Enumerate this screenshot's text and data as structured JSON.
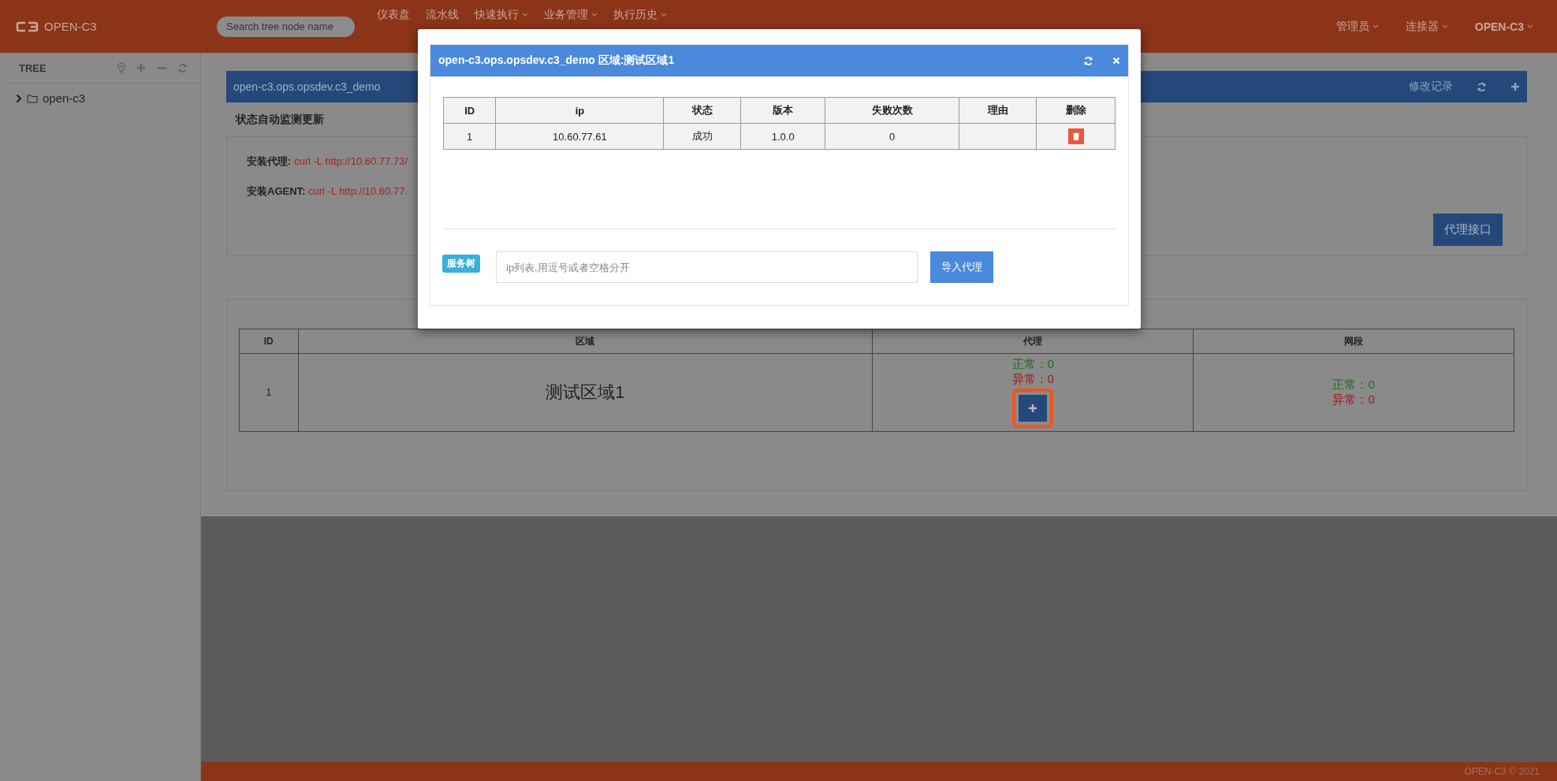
{
  "top_bar": {
    "logo": "OPEN-C3",
    "search": {
      "placeholder": "Search tree node name"
    },
    "menu": [
      {
        "label": "仪表盘",
        "dropdown": false
      },
      {
        "label": "流水线",
        "dropdown": false
      },
      {
        "label": "快速执行",
        "dropdown": true
      },
      {
        "label": "业务管理",
        "dropdown": true
      },
      {
        "label": "执行历史",
        "dropdown": true
      }
    ],
    "right_menu": [
      {
        "label": "管理员",
        "dropdown": true
      },
      {
        "label": "连接器",
        "dropdown": true
      },
      {
        "label": "OPEN-C3",
        "dropdown": true
      }
    ]
  },
  "sidebar": {
    "title": "TREE",
    "tree": [
      {
        "label": "open-c3",
        "expanded": false
      }
    ]
  },
  "main": {
    "header": {
      "title": "open-c3.ops.opsdev.c3_demo",
      "history_link": "修改记录"
    },
    "subtitle": "状态自动监测更新",
    "install": [
      {
        "label": "安装代理:",
        "command": "curl -L http://10.60.77.73/"
      },
      {
        "label": "安装AGENT:",
        "command": "curl -L http://10.60.77."
      }
    ],
    "proxy_button": "代理接口",
    "table": {
      "columns": [
        "ID",
        "区域",
        "代理",
        "网段"
      ],
      "rows": [
        {
          "id": "1",
          "region": "测试区域1",
          "proxy": {
            "normal": "正常：0",
            "abnormal": "异常：0",
            "add_highlighted": true
          },
          "segment": {
            "normal": "正常：0",
            "abnormal": "异常：0"
          }
        }
      ]
    }
  },
  "modal": {
    "title": "open-c3.ops.opsdev.c3_demo 区域:测试区域1",
    "columns": [
      "ID",
      "ip",
      "状态",
      "版本",
      "失败次数",
      "理由",
      "删除"
    ],
    "rows": [
      {
        "id": "1",
        "ip": "10.60.77.61",
        "status": "成功",
        "version": "1.0.0",
        "failures": "0"
      }
    ],
    "tag": "服务树",
    "input": {
      "placeholder": "ip列表,用逗号或者空格分开"
    },
    "import_button": "导入代理"
  },
  "footer": "OPEN-C3 © 2021"
}
